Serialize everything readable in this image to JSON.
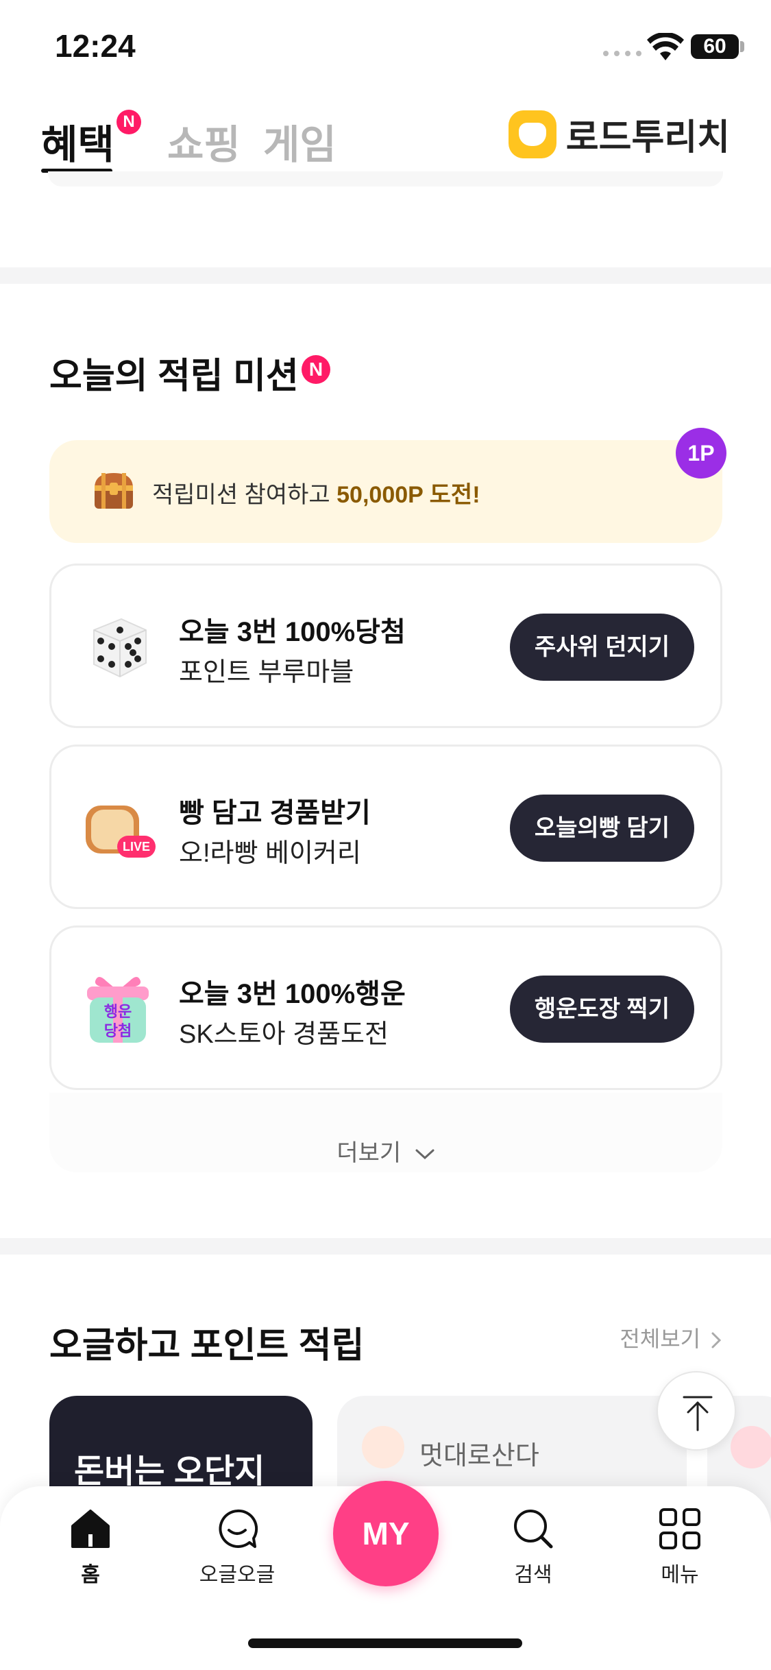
{
  "status_bar": {
    "time": "12:24",
    "battery": "60"
  },
  "top_tabs": [
    {
      "label": "혜택",
      "badge": "N"
    },
    {
      "label": "쇼핑"
    },
    {
      "label": "게임"
    }
  ],
  "brand": {
    "name": "로드투리치"
  },
  "mission_section": {
    "title": "오늘의 적립 미션",
    "badge": "N",
    "banner": {
      "text": "적립미션 참여하고 ",
      "highlight": "50,000P 도전!",
      "point_badge": "1P"
    },
    "items": [
      {
        "title": "오늘 3번 100%당첨",
        "subtitle": "포인트 부루마블",
        "button": "주사위 던지기",
        "icon": "dice-icon"
      },
      {
        "title": "빵 담고 경품받기",
        "subtitle": "오!라빵 베이커리",
        "button": "오늘의빵 담기",
        "icon": "bread-icon",
        "icon_badge": "LIVE"
      },
      {
        "title": "오늘 3번 100%행운",
        "subtitle": "SK스토아 경품도전",
        "button": "행운도장 찍기",
        "icon": "gift-box-icon",
        "icon_text": "행운\n당첨"
      }
    ],
    "more": "더보기"
  },
  "ogl_section": {
    "title": "오글하고 포인트 적립",
    "see_all": "전체보기",
    "cards": [
      {
        "title": "돈버는 오단지"
      },
      {
        "title": "멋대로산다"
      }
    ]
  },
  "bottom_nav": {
    "items": [
      {
        "label": "홈",
        "icon": "home-icon"
      },
      {
        "label": "오글오글",
        "icon": "chat-bubble-icon"
      },
      {
        "label": "검색",
        "icon": "search-icon"
      },
      {
        "label": "메뉴",
        "icon": "grid-menu-icon"
      }
    ],
    "center": "MY"
  },
  "colors": {
    "accent": "#ff1a66",
    "button_dark": "#262635",
    "my_button": "#ff3f86",
    "banner_bg": "#fff7e2",
    "point_badge": "#9b2ee6"
  }
}
